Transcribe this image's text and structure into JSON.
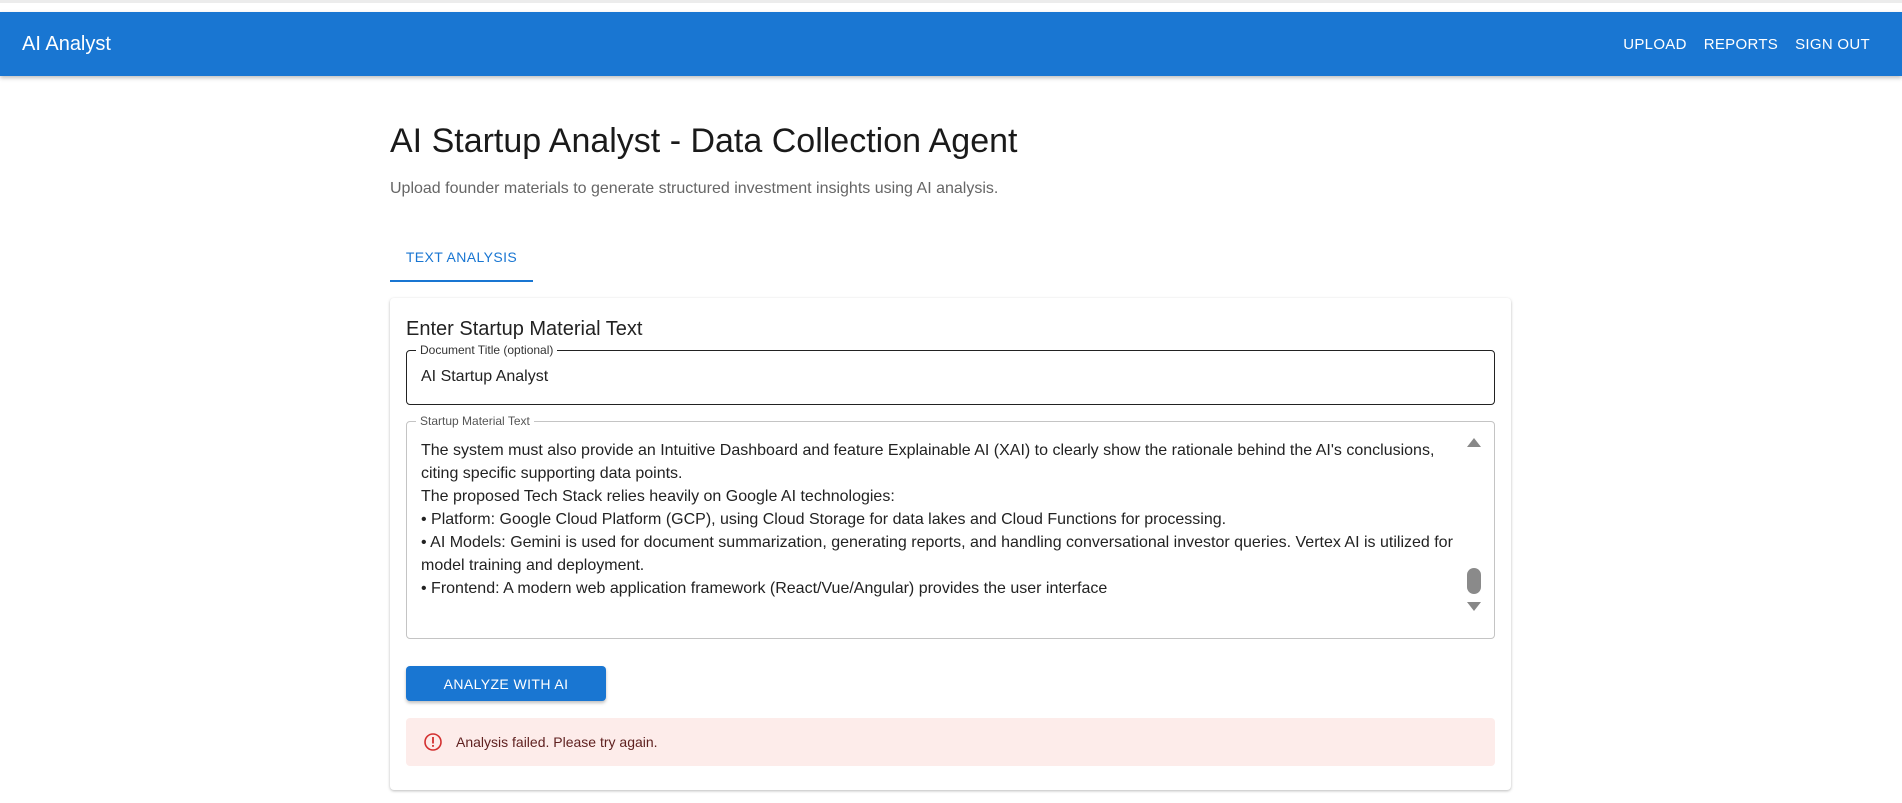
{
  "app": {
    "title": "AI Analyst",
    "nav": [
      "UPLOAD",
      "REPORTS",
      "SIGN OUT"
    ]
  },
  "page": {
    "title": "AI Startup Analyst - Data Collection Agent",
    "subtitle": "Upload founder materials to generate structured investment insights using AI analysis."
  },
  "tabs": [
    {
      "label": "TEXT ANALYSIS",
      "active": true
    }
  ],
  "form": {
    "card_title": "Enter Startup Material Text",
    "doc_title_label": "Document Title (optional)",
    "doc_title_value": "AI Startup Analyst",
    "material_label": "Startup Material Text",
    "material_lines": [
      "The system must also provide an Intuitive Dashboard and feature Explainable AI (XAI) to clearly show the rationale behind the AI's conclusions, citing specific supporting data points.",
      "The proposed Tech Stack relies heavily on Google AI technologies:",
      "• Platform: Google Cloud Platform (GCP), using Cloud Storage for data lakes and Cloud Functions for processing.",
      "• AI Models: Gemini is used for document summarization, generating reports, and handling conversational investor queries. Vertex AI is utilized for model training and deployment.",
      "• Frontend: A modern web application framework (React/Vue/Angular) provides the user interface"
    ],
    "analyze_label": "ANALYZE WITH AI"
  },
  "alert": {
    "severity": "error",
    "icon": "error-outline-icon",
    "message": "Analysis failed. Please try again."
  },
  "colors": {
    "primary": "#1976d2",
    "error_bg": "#fdecea",
    "error_icon": "#d32f2f",
    "error_text": "#5f2120"
  }
}
